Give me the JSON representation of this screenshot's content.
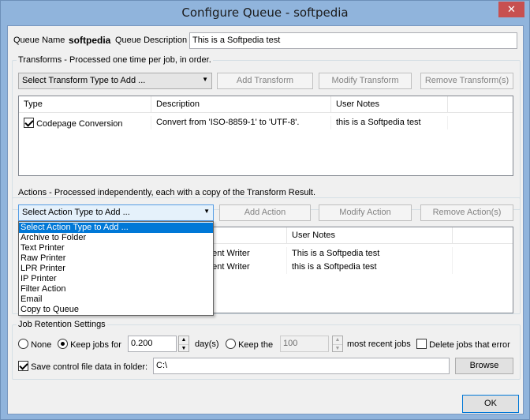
{
  "window": {
    "title": "Configure Queue - softpedia",
    "close_glyph": "✕"
  },
  "queue": {
    "name_label": "Queue Name",
    "name_value": "softpedia",
    "desc_label": "Queue Description",
    "desc_value": "This is a Softpedia test"
  },
  "transforms": {
    "group_title": "Transforms - Processed one time per job, in order.",
    "select_value": "Select Transform Type to Add ...",
    "add_label": "Add Transform",
    "modify_label": "Modify Transform",
    "remove_label": "Remove Transform(s)",
    "columns": [
      "Type",
      "Description",
      "User Notes"
    ],
    "rows": [
      {
        "checked": true,
        "type": "Codepage Conversion",
        "description": "Convert from 'ISO-8859-1' to 'UTF-8'.",
        "notes": "this is a Softpedia test"
      }
    ]
  },
  "actions": {
    "group_title": "Actions - Processed independently, each with a copy of the Transform Result.",
    "select_value": "Select Action Type to Add ...",
    "add_label": "Add Action",
    "modify_label": "Modify Action",
    "remove_label": "Remove Action(s)",
    "notes_header": "User Notes",
    "rows": [
      {
        "type_partial": "ment Writer",
        "notes": "This is a Softpedia test"
      },
      {
        "type_partial": "ment Writer",
        "notes": "this is a Softpedia test"
      }
    ],
    "dropdown_options": [
      "Select Action Type to Add ...",
      "Archive to Folder",
      "Text Printer",
      "Raw Printer",
      "LPR Printer",
      "IP Printer",
      "Filter Action",
      "Email",
      "Copy to Queue"
    ]
  },
  "retention": {
    "group_title": "Job Retention Settings",
    "none_label": "None",
    "keep_jobs_label": "Keep jobs for",
    "days_value": "0.200",
    "days_unit": "day(s)",
    "keep_the_label": "Keep the",
    "recent_value": "100",
    "recent_label": "most recent jobs",
    "delete_error_label": "Delete jobs that error",
    "save_control_label": "Save control file data in folder:",
    "folder_value": "C:\\",
    "browse_label": "Browse"
  },
  "footer": {
    "ok_label": "OK"
  },
  "colors": {
    "title_bar": "#90b4dc",
    "close_button": "#c75050",
    "selection": "#0078d7"
  }
}
